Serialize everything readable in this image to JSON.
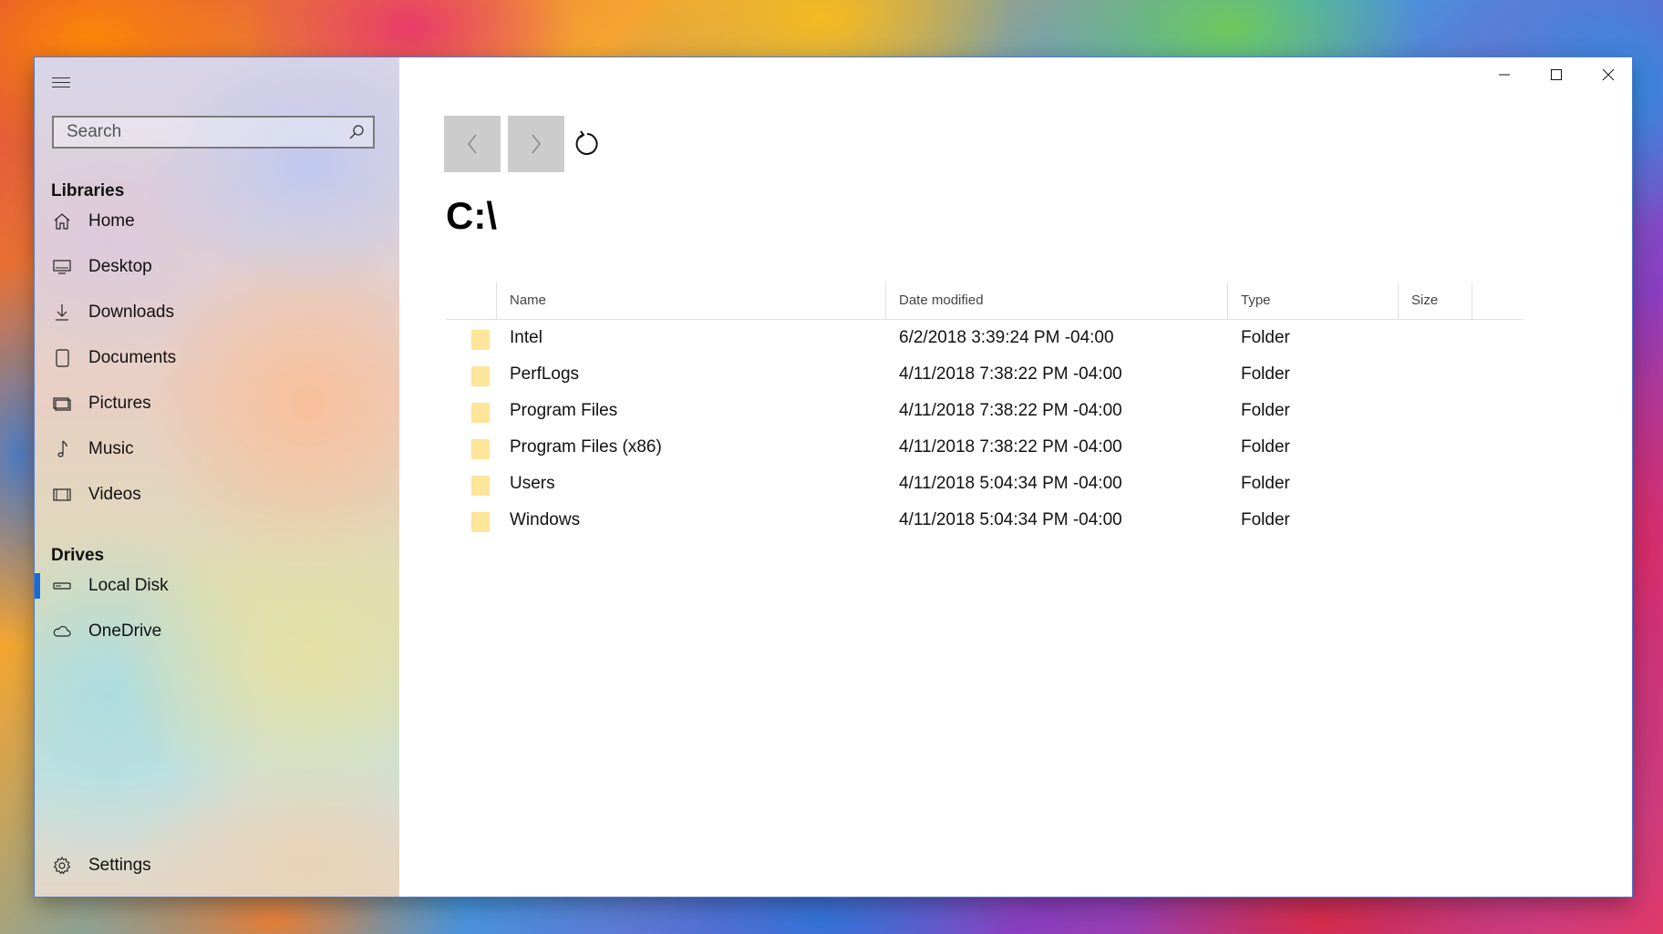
{
  "sidebar": {
    "search_placeholder": "Search",
    "libraries_title": "Libraries",
    "libraries": [
      {
        "label": "Home",
        "icon": "home-icon"
      },
      {
        "label": "Desktop",
        "icon": "desktop-icon"
      },
      {
        "label": "Downloads",
        "icon": "download-icon"
      },
      {
        "label": "Documents",
        "icon": "document-icon"
      },
      {
        "label": "Pictures",
        "icon": "pictures-icon"
      },
      {
        "label": "Music",
        "icon": "music-icon"
      },
      {
        "label": "Videos",
        "icon": "video-icon"
      }
    ],
    "drives_title": "Drives",
    "drives": [
      {
        "label": "Local Disk",
        "icon": "local-disk-icon",
        "active": true
      },
      {
        "label": "OneDrive",
        "icon": "cloud-icon",
        "active": false
      }
    ],
    "settings_label": "Settings",
    "accent_color": "#1a6ad6"
  },
  "main": {
    "path": "C:\\",
    "columns": {
      "name": "Name",
      "date": "Date modified",
      "type": "Type",
      "size": "Size"
    },
    "rows": [
      {
        "name": "Intel",
        "date": "6/2/2018 3:39:24 PM -04:00",
        "type": "Folder",
        "size": ""
      },
      {
        "name": "PerfLogs",
        "date": "4/11/2018 7:38:22 PM -04:00",
        "type": "Folder",
        "size": ""
      },
      {
        "name": "Program Files",
        "date": "4/11/2018 7:38:22 PM -04:00",
        "type": "Folder",
        "size": ""
      },
      {
        "name": "Program Files (x86)",
        "date": "4/11/2018 7:38:22 PM -04:00",
        "type": "Folder",
        "size": ""
      },
      {
        "name": "Users",
        "date": "4/11/2018 5:04:34 PM -04:00",
        "type": "Folder",
        "size": ""
      },
      {
        "name": "Windows",
        "date": "4/11/2018 5:04:34 PM -04:00",
        "type": "Folder",
        "size": ""
      }
    ],
    "folder_color": "#fde59a"
  }
}
